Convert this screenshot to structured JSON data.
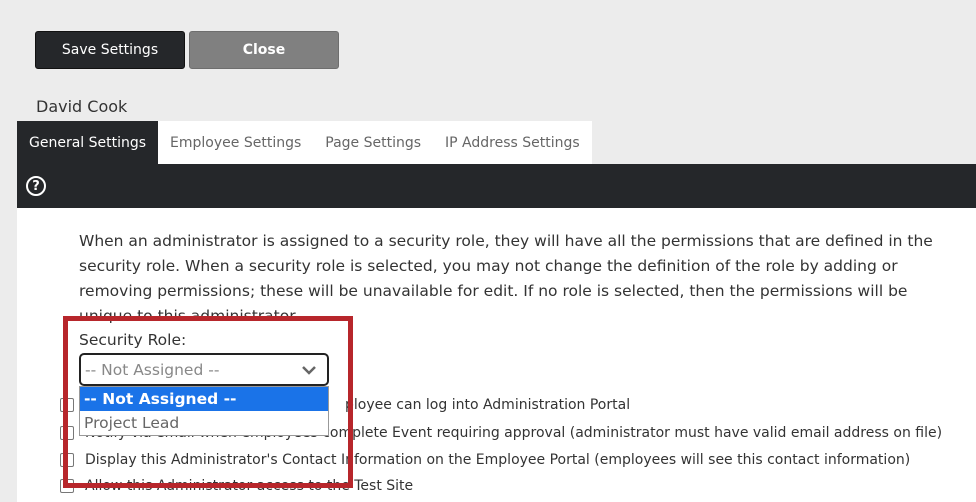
{
  "toolbar": {
    "save_label": "Save Settings",
    "close_label": "Close"
  },
  "user": {
    "name": "David Cook"
  },
  "tabs": [
    {
      "label": "General Settings"
    },
    {
      "label": "Employee Settings"
    },
    {
      "label": "Page Settings"
    },
    {
      "label": "IP Address Settings"
    }
  ],
  "help": {
    "icon": "?"
  },
  "description": "When an administrator is assigned to a security role, they will have all the permissions that are defined in the security role. When a security role is selected, you may not change the definition of the role by adding or removing permissions; these will be unavailable for edit. If no role is selected, then the permissions will be unique to this administrator.",
  "security_role": {
    "label": "Security Role:",
    "selected": "-- Not Assigned --",
    "options": [
      "-- Not Assigned --",
      "Project Lead"
    ]
  },
  "checkboxes": [
    {
      "label_visible": "ployee can log into Administration Portal"
    },
    {
      "label_visible": "Notify via email when employees complete Event requiring approval (administrator must have valid email address on file)"
    },
    {
      "label_visible": "Display this Administrator's Contact Information on the Employee Portal (employees will see this contact information)"
    },
    {
      "label_visible": "Allow this Administrator access to the Test Site"
    }
  ],
  "colors": {
    "dark": "#25272a",
    "highlight": "#b7262b",
    "selected": "#1a73e8"
  }
}
